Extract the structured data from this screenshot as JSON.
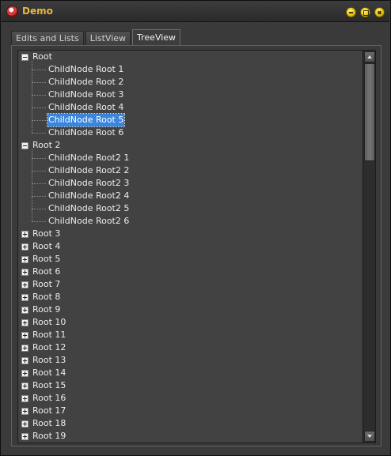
{
  "window": {
    "title": "Demo",
    "title_color": "#e8b640",
    "icons": [
      "app-icon",
      "minimize-icon",
      "maximize-icon",
      "close-icon"
    ]
  },
  "tabs": [
    {
      "label": "Edits and Lists",
      "active": false
    },
    {
      "label": "ListView",
      "active": false
    },
    {
      "label": "TreeView",
      "active": true
    }
  ],
  "tree": {
    "selection_color": "#3a86de",
    "nodes": [
      {
        "label": "Root",
        "expanded": true,
        "children": [
          {
            "label": "ChildNode Root 1"
          },
          {
            "label": "ChildNode Root 2"
          },
          {
            "label": "ChildNode Root 3"
          },
          {
            "label": "ChildNode Root 4"
          },
          {
            "label": "ChildNode Root 5",
            "selected": true
          },
          {
            "label": "ChildNode Root 6"
          }
        ]
      },
      {
        "label": "Root 2",
        "expanded": true,
        "children": [
          {
            "label": "ChildNode Root2 1"
          },
          {
            "label": "ChildNode Root2 2"
          },
          {
            "label": "ChildNode Root2 3"
          },
          {
            "label": "ChildNode Root2 4"
          },
          {
            "label": "ChildNode Root2 5"
          },
          {
            "label": "ChildNode Root2 6"
          }
        ]
      },
      {
        "label": "Root 3",
        "expanded": false
      },
      {
        "label": "Root 4",
        "expanded": false
      },
      {
        "label": "Root 5",
        "expanded": false
      },
      {
        "label": "Root 6",
        "expanded": false
      },
      {
        "label": "Root 7",
        "expanded": false
      },
      {
        "label": "Root 8",
        "expanded": false
      },
      {
        "label": "Root 9",
        "expanded": false
      },
      {
        "label": "Root 10",
        "expanded": false
      },
      {
        "label": "Root 11",
        "expanded": false
      },
      {
        "label": "Root 12",
        "expanded": false
      },
      {
        "label": "Root 13",
        "expanded": false
      },
      {
        "label": "Root 14",
        "expanded": false
      },
      {
        "label": "Root 15",
        "expanded": false
      },
      {
        "label": "Root 16",
        "expanded": false
      },
      {
        "label": "Root 17",
        "expanded": false
      },
      {
        "label": "Root 18",
        "expanded": false
      },
      {
        "label": "Root 19",
        "expanded": false
      }
    ]
  },
  "scrollbar": {
    "position": 0.0,
    "visible_fraction": 0.27
  }
}
